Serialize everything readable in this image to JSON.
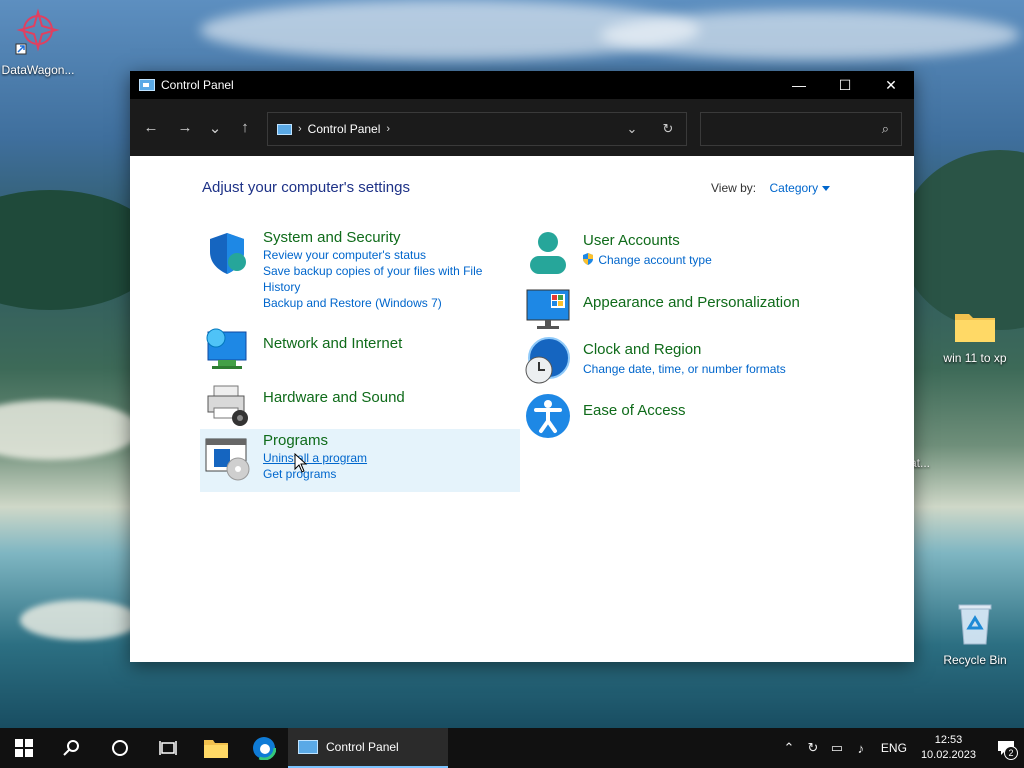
{
  "desktop": {
    "icons": [
      {
        "label": "DataWagon..."
      },
      {
        "label": "win 11 to xp"
      },
      {
        "label": "Recycle Bin"
      },
      {
        "label": "at..."
      }
    ]
  },
  "window": {
    "title": "Control Panel",
    "controls": {
      "minimize": "—",
      "maximize": "☐",
      "close": "✕"
    }
  },
  "navbar": {
    "back": "←",
    "forward": "→",
    "recent": "⌄",
    "up": "↑",
    "breadcrumb": "Control Panel",
    "separator": "›",
    "dropdown": "⌄",
    "refresh": "↻",
    "search_placeholder": "",
    "search_icon": "⌕"
  },
  "content": {
    "heading": "Adjust your computer's settings",
    "view_by_label": "View by:",
    "view_by_value": "Category",
    "left_categories": [
      {
        "title": "System and Security",
        "links": [
          "Review your computer's status",
          "Save backup copies of your files with File History",
          "Backup and Restore (Windows 7)"
        ]
      },
      {
        "title": "Network and Internet",
        "links": []
      },
      {
        "title": "Hardware and Sound",
        "links": []
      },
      {
        "title": "Programs",
        "links": [
          "Uninstall a program",
          "Get programs"
        ]
      }
    ],
    "right_categories": [
      {
        "title": "User Accounts",
        "links": [
          "Change account type"
        ]
      },
      {
        "title": "Appearance and Personalization",
        "links": []
      },
      {
        "title": "Clock and Region",
        "links": [
          "Change date, time, or number formats"
        ]
      },
      {
        "title": "Ease of Access",
        "links": []
      }
    ]
  },
  "taskbar": {
    "active_app": "Control Panel",
    "language": "ENG",
    "time": "12:53",
    "date": "10.02.2023",
    "notifications": "2"
  },
  "colors": {
    "category_title": "#0f6b1a",
    "link": "#0066cc",
    "heading": "#1e3287",
    "hover": "#e5f3fb"
  }
}
